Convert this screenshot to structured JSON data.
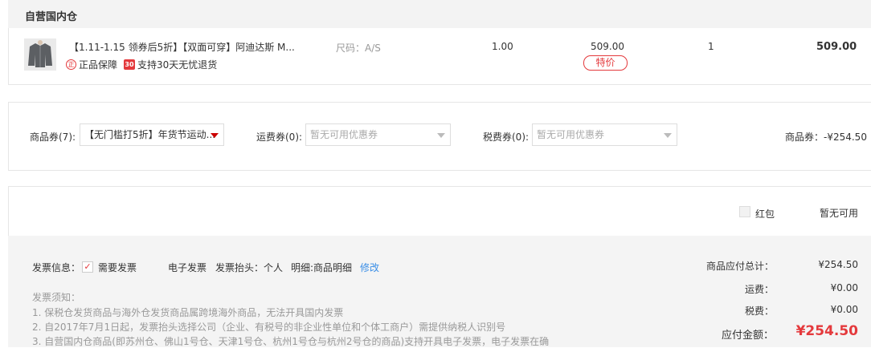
{
  "warehouse": {
    "title": "自营国内仓"
  },
  "product": {
    "name": "【1.11-1.15 领券后5折】【双面可穿】阿迪达斯 M...",
    "badge_genuine_icon": "正",
    "badge_genuine": "正品保障",
    "badge_return_icon": "30",
    "badge_return": "支持30天无忧退货",
    "size": "尺码：A/S",
    "weight": "1.00",
    "unit_price": "509.00",
    "tag": "特价",
    "quantity": "1",
    "total": "509.00",
    "thumbnail_icon": "jacket-image"
  },
  "coupons": {
    "goods_label": "商品券(7):",
    "goods_value": "【无门槛打5折】年货节运动...",
    "shipping_label": "运费券(0):",
    "shipping_value": "暂无可用优惠券",
    "tax_label": "税费券(0):",
    "tax_value": "暂无可用优惠券",
    "discount_text": "商品券：-¥254.50"
  },
  "red_packet": {
    "label": "红包",
    "status": "暂无可用"
  },
  "invoice": {
    "label": "发票信息：",
    "check_mark": "✓",
    "need": "需要发票",
    "type": "电子发票",
    "header": "发票抬头：个人",
    "detail": "明细:商品明细",
    "modify": "修改",
    "notes_title": "发票须知：",
    "notes": [
      "1. 保税仓发货商品与海外仓发货商品属跨境海外商品，无法开具国内发票",
      "2. 自2017年7月1日起，发票抬头选择公司（企业、有税号的非企业性单位和个体工商户）需提供纳税人识别号",
      "3. 自营国内仓商品(即苏州仓、佛山1号仓、天津1号仓、杭州1号仓与杭州2号仓的商品)支持开具电子发票，电子发票在确"
    ]
  },
  "summary": {
    "goods_total_label": "商品应付总计：",
    "goods_total": "¥254.50",
    "shipping_label": "运费：",
    "shipping": "¥0.00",
    "tax_label": "税费：",
    "tax": "¥0.00",
    "payable_label": "应付金额：",
    "payable": "¥254.50"
  },
  "colors": {
    "accent": "#e4393c",
    "link": "#3a8ee6",
    "panel_bg": "#f4f4f4"
  }
}
